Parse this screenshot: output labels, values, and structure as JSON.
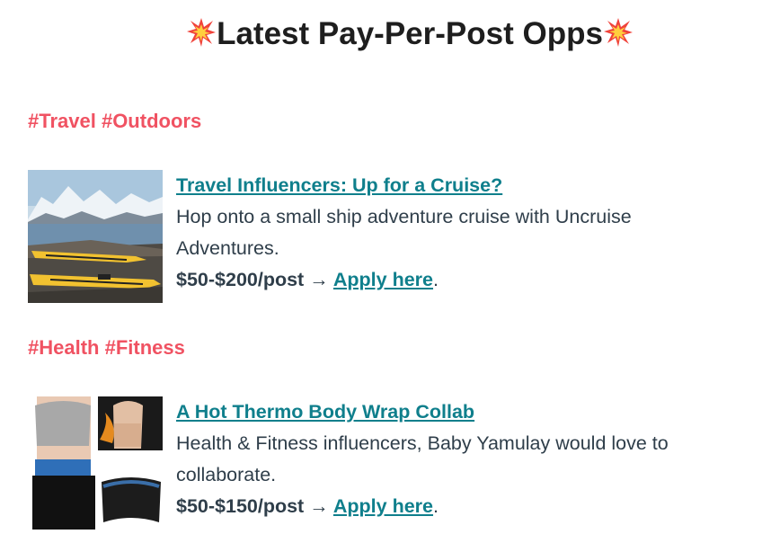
{
  "header": {
    "title": "Latest Pay-Per-Post Opps",
    "spark_icon": "collision-emoji"
  },
  "sections": [
    {
      "tags": "#Travel #Outdoors",
      "item": {
        "title": "Travel Influencers: Up for a Cruise?",
        "desc_line1": "Hop onto a small ship adventure cruise with Uncruise",
        "desc_line2": "Adventures.",
        "price": "$50-$200/post",
        "arrow": "→",
        "apply_label": "Apply here",
        "end": "."
      }
    },
    {
      "tags": "#Health #Fitness",
      "item": {
        "title": "A Hot Thermo Body Wrap Collab",
        "desc_line1": "Health & Fitness influencers, Baby Yamulay would love to",
        "desc_line2": "collaborate.",
        "price": "$50-$150/post",
        "arrow": "→",
        "apply_label": "Apply here",
        "end": "."
      }
    }
  ],
  "colors": {
    "tag": "#f05262",
    "link": "#0f7f8c",
    "text": "#2f3e4a",
    "title": "#1e1e1e"
  }
}
